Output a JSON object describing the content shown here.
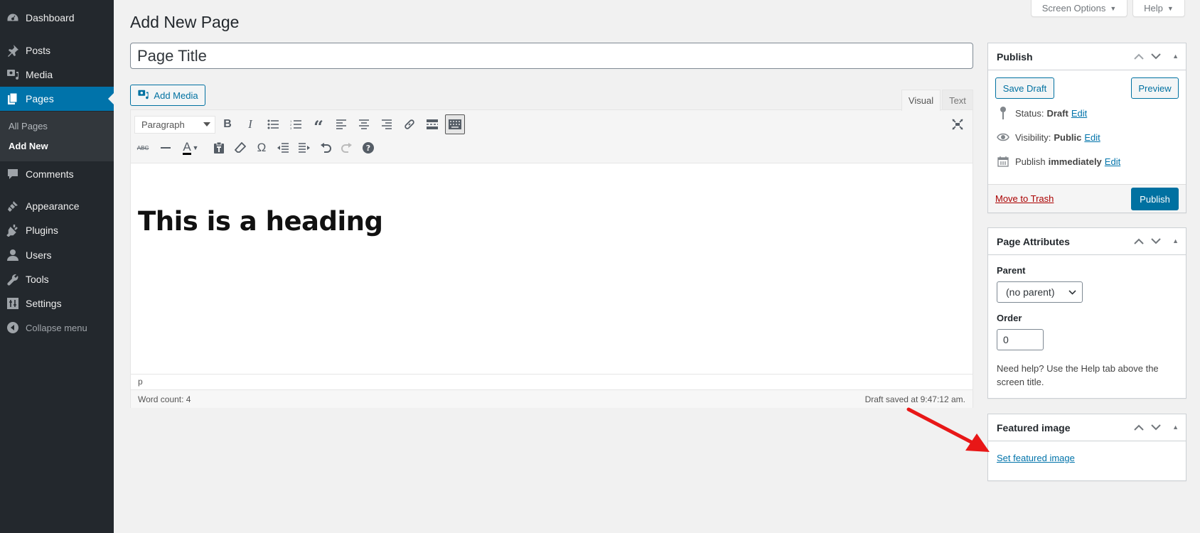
{
  "sidebar": {
    "items": [
      {
        "label": "Dashboard",
        "icon": "dashboard-icon"
      },
      {
        "label": "Posts",
        "icon": "pin-icon"
      },
      {
        "label": "Media",
        "icon": "media-icon"
      },
      {
        "label": "Pages",
        "icon": "pages-icon",
        "active": true
      },
      {
        "label": "Comments",
        "icon": "comment-icon"
      },
      {
        "label": "Appearance",
        "icon": "paintbrush-icon"
      },
      {
        "label": "Plugins",
        "icon": "plugin-icon"
      },
      {
        "label": "Users",
        "icon": "user-icon"
      },
      {
        "label": "Tools",
        "icon": "wrench-icon"
      },
      {
        "label": "Settings",
        "icon": "settings-icon"
      }
    ],
    "submenu": [
      {
        "label": "All Pages"
      },
      {
        "label": "Add New",
        "current": true
      }
    ],
    "collapse_label": "Collapse menu"
  },
  "top": {
    "screen_options": "Screen Options",
    "help": "Help"
  },
  "main": {
    "page_title": "Add New Page",
    "title_value": "Page Title",
    "add_media": "Add Media",
    "tabs": [
      {
        "label": "Visual"
      },
      {
        "label": "Text"
      }
    ],
    "format_select": "Paragraph",
    "content_heading": "This is a heading",
    "path": "p",
    "word_count": "Word count: 4",
    "draft_saved": "Draft saved at 9:47:12 am."
  },
  "publish": {
    "title": "Publish",
    "save_draft": "Save Draft",
    "preview": "Preview",
    "status_label": "Status:",
    "status_value": "Draft",
    "visibility_label": "Visibility:",
    "visibility_value": "Public",
    "schedule_label": "Publish",
    "schedule_value": "immediately",
    "edit": "Edit",
    "trash": "Move to Trash",
    "publish_btn": "Publish"
  },
  "attributes": {
    "title": "Page Attributes",
    "parent_label": "Parent",
    "parent_value": "(no parent)",
    "order_label": "Order",
    "order_value": "0",
    "help_text": "Need help? Use the Help tab above the screen title."
  },
  "featured": {
    "title": "Featured image",
    "link": "Set featured image"
  },
  "colors": {
    "sidebar_bg": "#23282d",
    "accent": "#0073aa",
    "annotation_arrow": "#e81717"
  }
}
